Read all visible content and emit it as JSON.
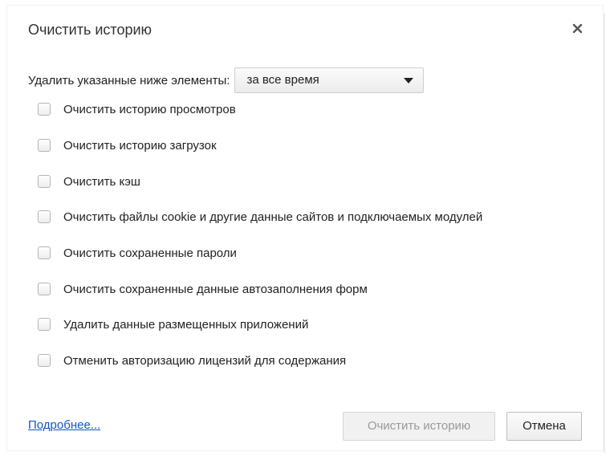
{
  "dialog": {
    "title": "Очистить историю",
    "close_icon": "close-icon"
  },
  "range": {
    "label": "Удалить указанные ниже элементы:",
    "selected": "за все время"
  },
  "options": [
    {
      "label": "Очистить историю просмотров",
      "checked": false
    },
    {
      "label": "Очистить историю загрузок",
      "checked": false
    },
    {
      "label": "Очистить кэш",
      "checked": false
    },
    {
      "label": "Очистить файлы cookie и другие данные сайтов и подключаемых модулей",
      "checked": false
    },
    {
      "label": "Очистить сохраненные пароли",
      "checked": false
    },
    {
      "label": "Очистить сохраненные данные автозаполнения форм",
      "checked": false
    },
    {
      "label": "Удалить данные размещенных приложений",
      "checked": false
    },
    {
      "label": "Отменить авторизацию лицензий для содержания",
      "checked": false
    }
  ],
  "footer": {
    "more_link": "Подробнее...",
    "clear_button": "Очистить историю",
    "cancel_button": "Отмена"
  },
  "colors": {
    "link": "#1155cc",
    "disabled_text": "#9a9a9a"
  }
}
